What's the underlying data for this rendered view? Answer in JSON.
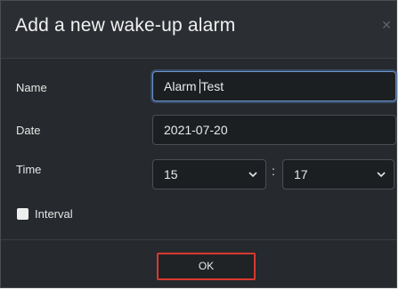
{
  "dialog": {
    "title": "Add a new wake-up alarm",
    "close_icon": "close-icon"
  },
  "form": {
    "name_label": "Name",
    "name_value": "Alarm Test",
    "name_value_before_caret": "Alarm ",
    "name_value_after_caret": "Test",
    "date_label": "Date",
    "date_value": "2021-07-20",
    "time_label": "Time",
    "hour_value": "15",
    "minute_value": "17",
    "time_separator": ":",
    "interval_label": "Interval",
    "interval_checked": false
  },
  "footer": {
    "ok_label": "OK",
    "ok_highlight_color": "#d9382e"
  },
  "colors": {
    "dialog_bg": "#26292d",
    "input_bg": "#1c1f22",
    "focus_border": "#6f95c9"
  }
}
